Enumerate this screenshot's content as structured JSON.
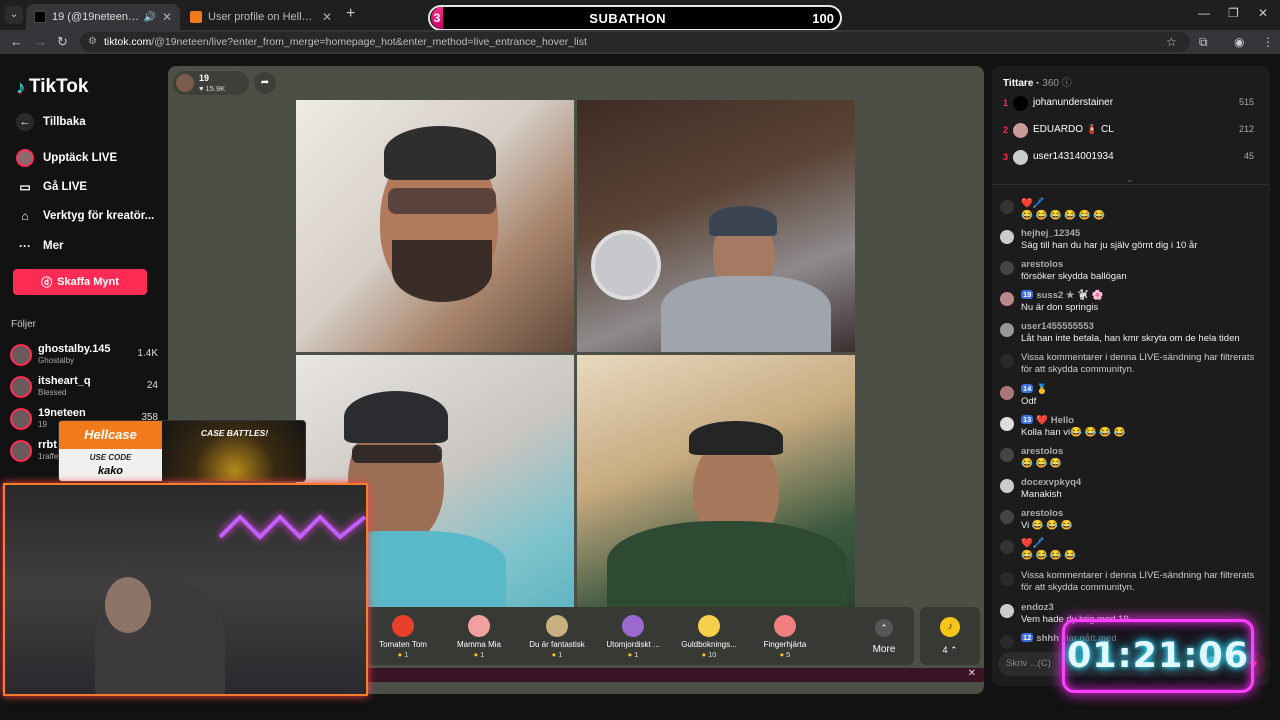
{
  "browser": {
    "tabs": [
      {
        "title": "19 (@19neteen) är LIVE - TikTok",
        "active": true
      },
      {
        "title": "User profile on Hellcase",
        "active": false
      }
    ],
    "url_host": "tiktok.com",
    "url_path": "/@19neteen/live?enter_from_merge=homepage_hot&enter_method=live_entrance_hover_list"
  },
  "subathon": {
    "left": "3",
    "label": "SUBATHON",
    "right": "100"
  },
  "sidebar": {
    "logo": "TikTok",
    "back": "Tillbaka",
    "nav": [
      "Upptäck LIVE",
      "Gå LIVE",
      "Verktyg för kreatör...",
      "Mer"
    ],
    "coin_button": "Skaffa Mynt",
    "follows_label": "Följer",
    "follows": [
      {
        "name": "ghostalby.145",
        "sub": "Ghostalby",
        "count": "1.4K"
      },
      {
        "name": "itsheart_q",
        "sub": "Blessed",
        "count": "24"
      },
      {
        "name": "19neteen",
        "sub": "19",
        "count": "358"
      },
      {
        "name": "rrbt",
        "sub": "1raffe",
        "count": ""
      }
    ]
  },
  "stream": {
    "host_name": "19",
    "host_likes": "15.9K",
    "gifts": [
      {
        "name": "Tomaten Tom",
        "price": "1",
        "color": "#e8402a"
      },
      {
        "name": "Mamma Mia",
        "price": "1",
        "color": "#f0a0a0"
      },
      {
        "name": "Du är fantastisk",
        "price": "1",
        "color": "#c8b080"
      },
      {
        "name": "Utomjordiskt ...",
        "price": "1",
        "color": "#9a6ad0"
      },
      {
        "name": "Guldboknings...",
        "price": "10",
        "color": "#f5d04a"
      },
      {
        "name": "Fingerhjärta",
        "price": "5",
        "color": "#f08080"
      }
    ],
    "more_label": "More",
    "coin_count": "4"
  },
  "chat": {
    "viewers_label": "Tittare",
    "viewers_count": "360",
    "top": [
      {
        "rank": "1",
        "name": "johanunderstainer",
        "score": "515"
      },
      {
        "rank": "2",
        "name": "EDUARDO 🧯 CL",
        "score": "212"
      },
      {
        "rank": "3",
        "name": "user14314001934",
        "score": "45"
      }
    ],
    "messages": [
      {
        "user": "❤️🖊️",
        "text": "😂 😂 😂 😂 😂 😂"
      },
      {
        "user": "hejhej_12345",
        "text": "Säg till han du har ju själv gömt dig i 10 år"
      },
      {
        "user": "arestolos",
        "text": "försöker skydda ballögan"
      },
      {
        "user": "suss2 ★ 🐩 🌸",
        "badge": "19",
        "text": "Nu är don springis"
      },
      {
        "user": "user1455555553",
        "text": "Låt han inte betala, han kmr skryta om de hela tiden"
      },
      {
        "system": "Vissa kommentarer i denna LIVE-sändning har filtrerats för att skydda communityn."
      },
      {
        "user": "🥇",
        "badge": "14",
        "text": "Odf"
      },
      {
        "user": "❤️ Hello",
        "badge": "13",
        "text": "Kolla han vi😂 😂 😂 😂"
      },
      {
        "user": "arestolos",
        "text": "😂 😂 😂"
      },
      {
        "user": "docexvpkyq4",
        "text": "Manakish"
      },
      {
        "user": "arestolos",
        "text": "Vi 😂 😂 😂"
      },
      {
        "user": "❤️🖊️",
        "text": "😂 😂 😂 😂"
      },
      {
        "system": "Vissa kommentarer i denna LIVE-sändning har filtrerats för att skydda communityn."
      },
      {
        "user": "endoz3",
        "text": "Vem hade dy krig med 19"
      },
      {
        "user": "shhh",
        "badge": "12",
        "text": "Har gått med"
      }
    ],
    "input_placeholder": "Skriv ...(C)"
  },
  "overlays": {
    "hellcase_brand": "Hellcase",
    "hellcase_use_code": "USE CODE",
    "hellcase_code": "kako",
    "hellcase_case_battles": "CASE BATTLES!",
    "timer": "01:21:06"
  }
}
